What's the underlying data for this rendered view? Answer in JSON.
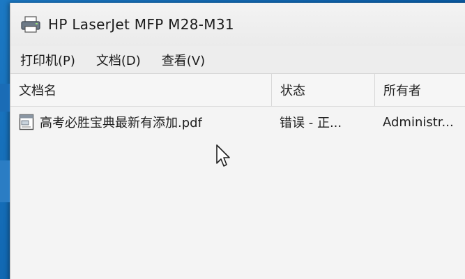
{
  "window": {
    "title": "HP LaserJet MFP M28-M31"
  },
  "menu": {
    "items": [
      "打印机(P)",
      "文档(D)",
      "查看(V)"
    ]
  },
  "table": {
    "headers": [
      "文档名",
      "状态",
      "所有者"
    ],
    "rows": [
      {
        "name": "高考必胜宝典最新有添加.pdf",
        "status": "错误 - 正...",
        "owner": "Administr..."
      }
    ]
  },
  "icons": {
    "title": "printer-icon",
    "row": "document-icon",
    "cursor": "mouse-pointer-icon"
  },
  "colors": {
    "window_bg": "#ececec",
    "desktop": "#0b5ea8"
  }
}
